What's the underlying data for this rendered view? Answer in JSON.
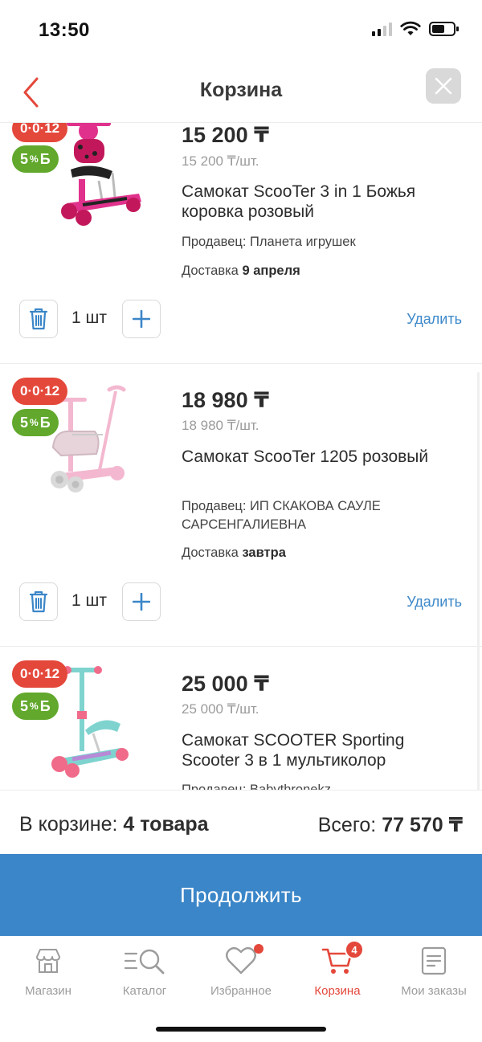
{
  "status": {
    "time": "13:50"
  },
  "header": {
    "title": "Корзина"
  },
  "items": [
    {
      "installment_badge": "0·0·12",
      "bonus_value": "5",
      "bonus_suffix": "%",
      "bonus_symbol": "Б",
      "price": "15 200 ₸",
      "unit_price": "15 200 ₸/шт.",
      "name": "Самокат ScooTer 3 in 1 Божья коровка розовый",
      "seller_label": "Продавец:",
      "seller": "Планета игрушек",
      "delivery_label": "Доставка",
      "delivery_date": "9 апреля",
      "quantity": "1 шт",
      "remove_label": "Удалить",
      "colors": {
        "frame": "#e0328c",
        "wheels": "#c2185b"
      }
    },
    {
      "installment_badge": "0·0·12",
      "bonus_value": "5",
      "bonus_suffix": "%",
      "bonus_symbol": "Б",
      "price": "18 980 ₸",
      "unit_price": "18 980 ₸/шт.",
      "name": "Самокат ScooTer 1205 розовый",
      "seller_label": "Продавец:",
      "seller": "ИП СКАКОВА САУЛЕ САРСЕНГАЛИЕВНА",
      "delivery_label": "Доставка",
      "delivery_date": "завтра",
      "quantity": "1 шт",
      "remove_label": "Удалить",
      "colors": {
        "frame": "#f3b8cf",
        "wheels": "#d9d9d9"
      }
    },
    {
      "installment_badge": "0·0·12",
      "bonus_value": "5",
      "bonus_suffix": "%",
      "bonus_symbol": "Б",
      "price": "25 000 ₸",
      "unit_price": "25 000 ₸/шт.",
      "name": "Самокат SCOOTER Sporting Scooter 3 в 1 мультиколор",
      "seller_label": "Продавец:",
      "seller": "Babythronekz",
      "colors": {
        "frame": "#7fd3cf",
        "wheels": "#f06b8a"
      }
    }
  ],
  "summary": {
    "count_label": "В корзине:",
    "count_value": "4 товара",
    "total_label": "Всего:",
    "total_value": "77 570 ₸"
  },
  "continue_label": "Продолжить",
  "tabs": [
    {
      "label": "Магазин",
      "icon": "shop-icon"
    },
    {
      "label": "Каталог",
      "icon": "catalog-search-icon"
    },
    {
      "label": "Избранное",
      "icon": "heart-icon"
    },
    {
      "label": "Корзина",
      "icon": "cart-icon",
      "active": true,
      "badge": "4"
    },
    {
      "label": "Мои заказы",
      "icon": "orders-icon"
    }
  ],
  "colors": {
    "accent": "#e4483b",
    "primary": "#3b86c8",
    "bonus": "#61a82c"
  }
}
